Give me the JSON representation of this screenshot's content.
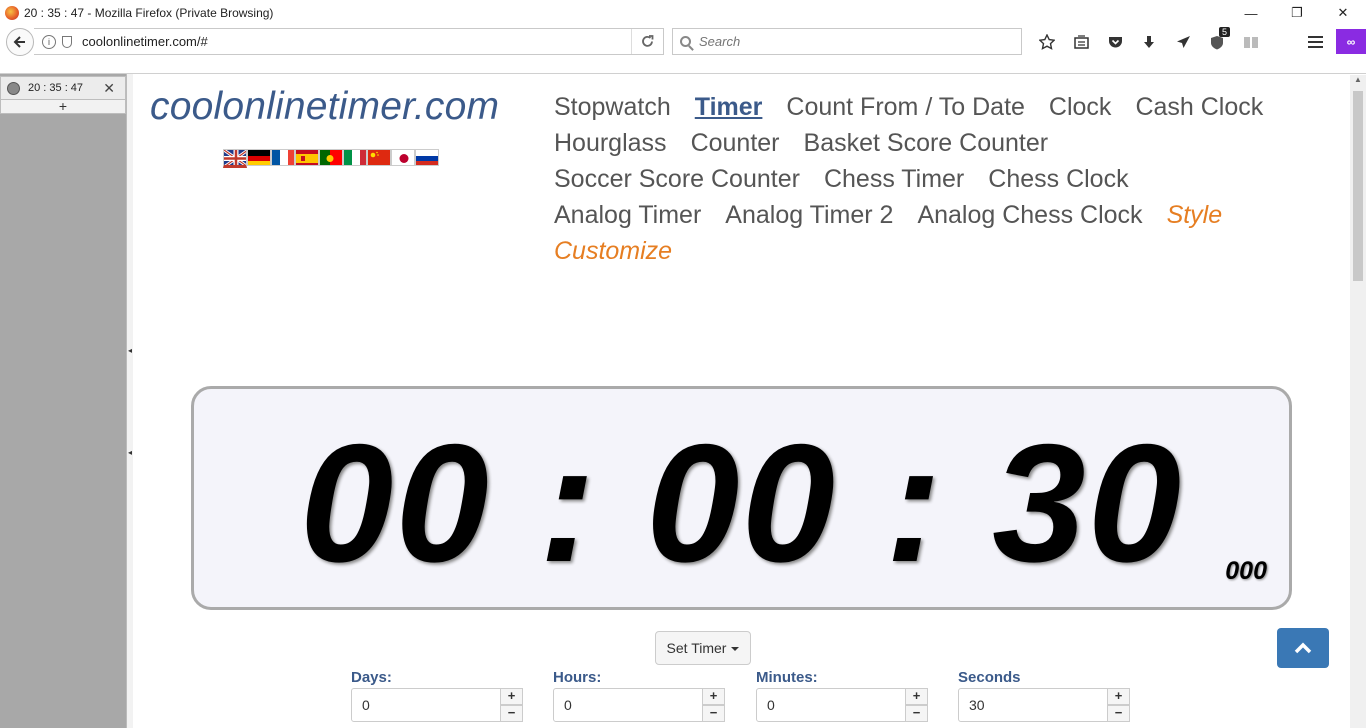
{
  "window": {
    "title": "20 : 35 : 47 - Mozilla Firefox (Private Browsing)",
    "minimize": "—",
    "restore": "❐",
    "close": "✕"
  },
  "browser": {
    "url": "coolonlinetimer.com/#",
    "search_placeholder": "Search",
    "downloads_badge": "5",
    "private_icon": "∞",
    "back_icon": "arrow-left-icon",
    "reload_icon": "reload-icon"
  },
  "sidebar": {
    "tab_title": "20 : 35 : 47",
    "close": "✕",
    "add": "+"
  },
  "site": {
    "logo": "coolonlinetimer.com",
    "flags": [
      "en",
      "de",
      "fr",
      "es",
      "pt",
      "it",
      "zh",
      "ja",
      "ru"
    ],
    "menu": [
      {
        "label": "Stopwatch",
        "style": "normal"
      },
      {
        "label": "Timer",
        "style": "active"
      },
      {
        "label": "Count From / To Date",
        "style": "normal"
      },
      {
        "label": "Clock",
        "style": "normal"
      },
      {
        "label": "Cash Clock",
        "style": "normal"
      },
      {
        "label": "Hourglass",
        "style": "normal"
      },
      {
        "label": "Counter",
        "style": "normal"
      },
      {
        "label": "Basket Score Counter",
        "style": "normal"
      },
      {
        "label": "Soccer Score Counter",
        "style": "normal"
      },
      {
        "label": "Chess Timer",
        "style": "normal"
      },
      {
        "label": "Chess Clock",
        "style": "normal"
      },
      {
        "label": "Analog Timer",
        "style": "normal"
      },
      {
        "label": "Analog Timer 2",
        "style": "normal"
      },
      {
        "label": "Analog Chess Clock",
        "style": "normal"
      },
      {
        "label": "Style",
        "style": "orange"
      },
      {
        "label": "Customize",
        "style": "orange"
      }
    ]
  },
  "timer": {
    "display": "00 : 00 : 30",
    "milliseconds": "000"
  },
  "controls": {
    "set_timer_label": "Set Timer",
    "fields": [
      {
        "label": "Days:",
        "value": "0"
      },
      {
        "label": "Hours:",
        "value": "0"
      },
      {
        "label": "Minutes:",
        "value": "0"
      },
      {
        "label": "Seconds",
        "value": "30"
      }
    ],
    "plus": "+",
    "minus": "−"
  },
  "colors": {
    "accent": "#3b5a8a",
    "orange": "#e67e22",
    "scroll_top_button": "#3a78b5",
    "private": "#8a2be2"
  }
}
